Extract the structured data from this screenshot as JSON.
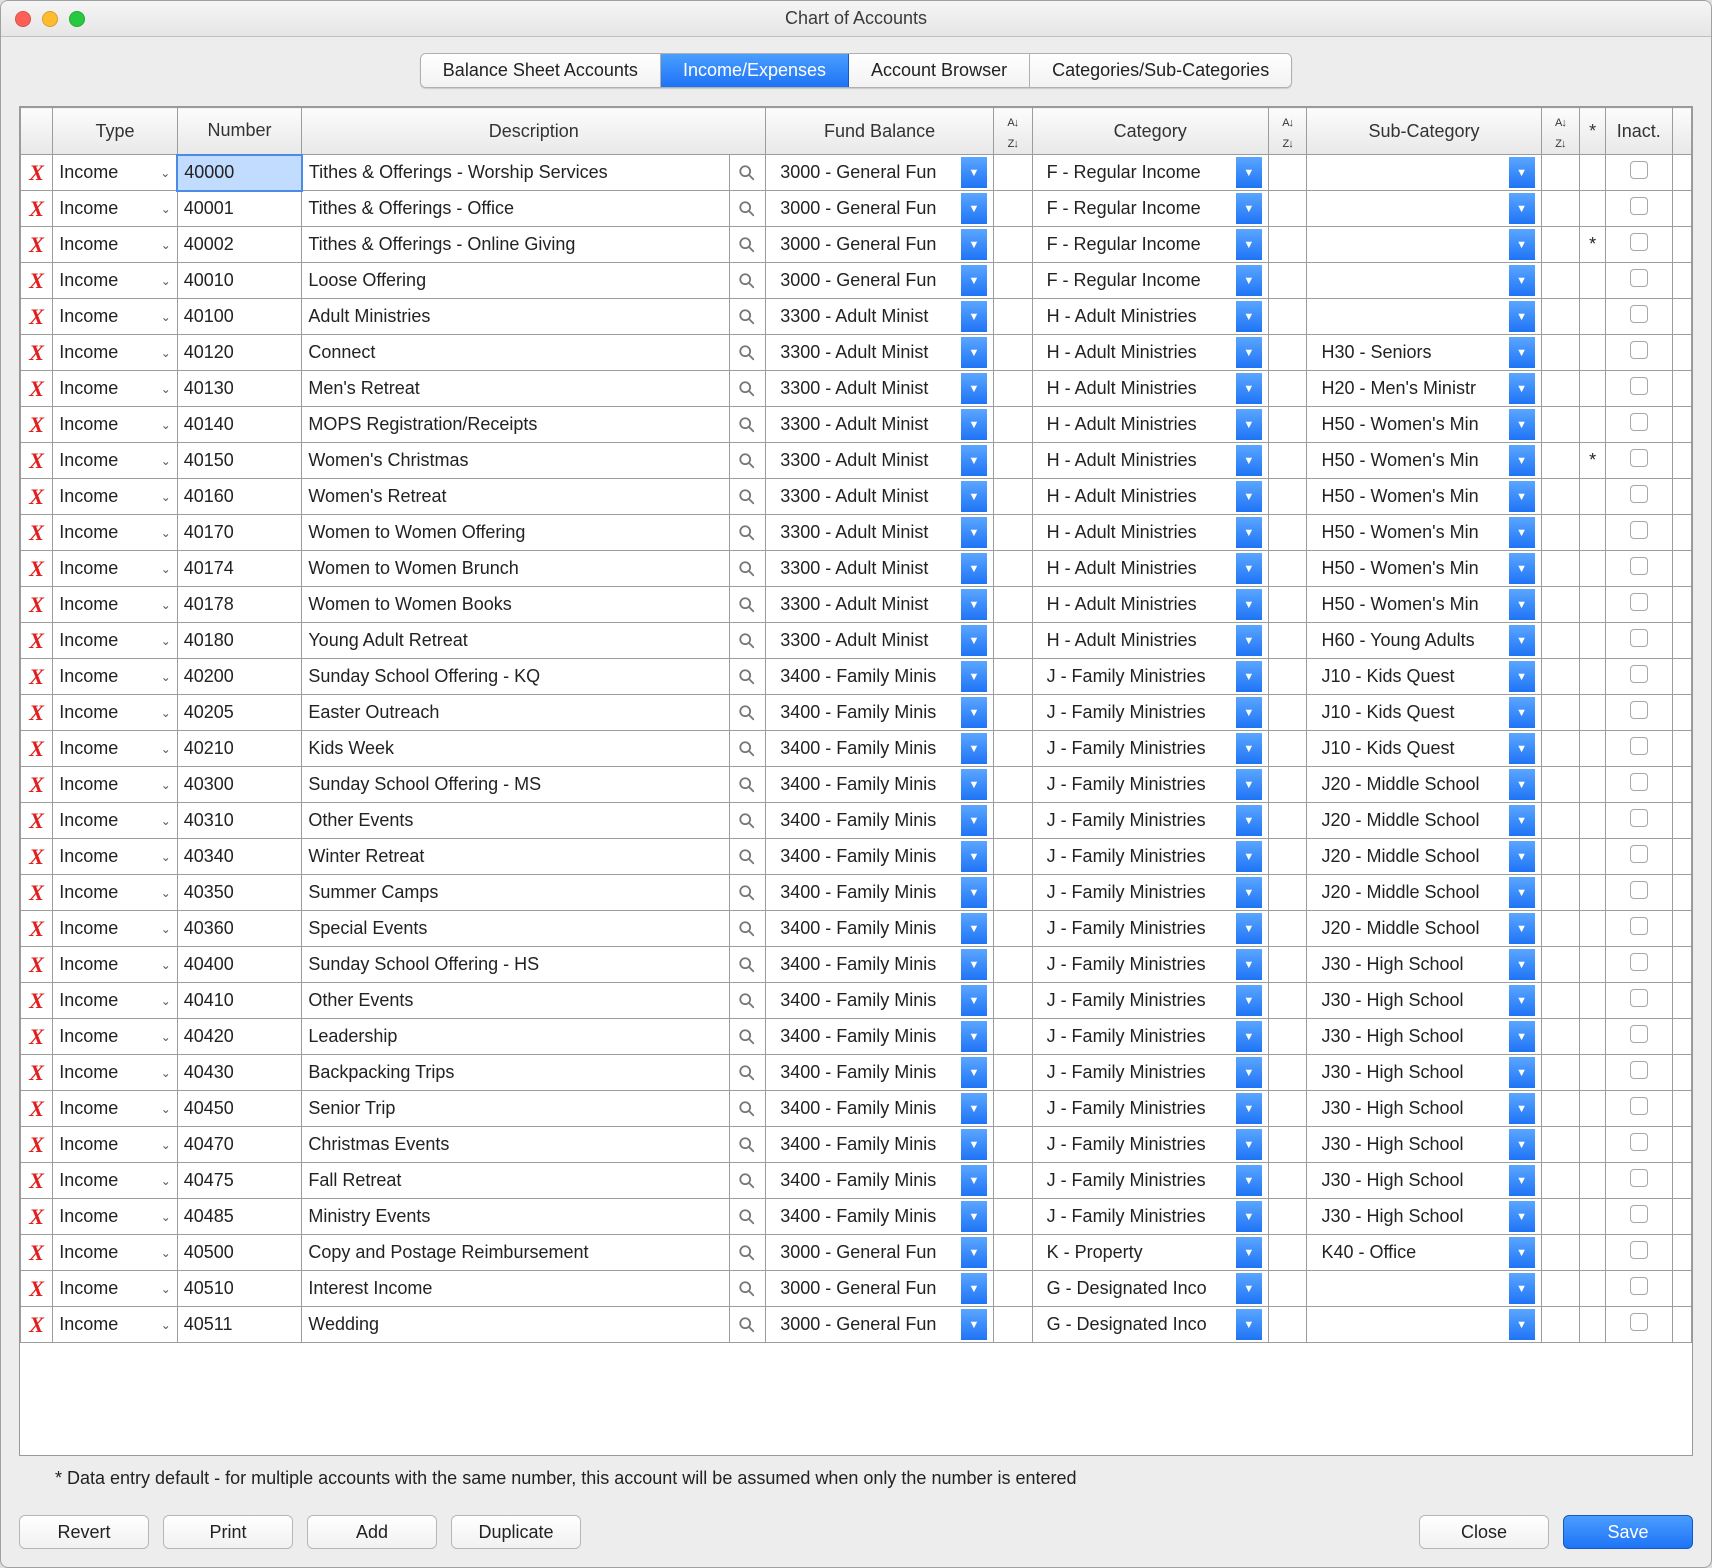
{
  "window": {
    "title": "Chart of Accounts"
  },
  "tabs": [
    {
      "id": "balance",
      "label": "Balance Sheet Accounts",
      "active": false
    },
    {
      "id": "income",
      "label": "Income/Expenses",
      "active": true
    },
    {
      "id": "browser",
      "label": "Account Browser",
      "active": false
    },
    {
      "id": "cats",
      "label": "Categories/Sub-Categories",
      "active": false
    }
  ],
  "headers": {
    "type": "Type",
    "number": "Number",
    "description": "Description",
    "fund": "Fund Balance",
    "category": "Category",
    "subcategory": "Sub-Category",
    "star": "*",
    "inact": "Inact."
  },
  "footnote": "* Data entry default - for multiple accounts with the same number, this account will be assumed when only the number is entered",
  "buttons": {
    "revert": "Revert",
    "print": "Print",
    "add": "Add",
    "duplicate": "Duplicate",
    "close": "Close",
    "save": "Save"
  },
  "rows": [
    {
      "type": "Income",
      "number": "40000",
      "number_selected": true,
      "desc": "Tithes & Offerings - Worship Services",
      "fund": "3000 - General Fun",
      "cat": "F - Regular Income",
      "sub": "",
      "star": "",
      "inact": false
    },
    {
      "type": "Income",
      "number": "40001",
      "desc": "Tithes & Offerings - Office",
      "fund": "3000 - General Fun",
      "cat": "F - Regular Income",
      "sub": "",
      "star": "",
      "inact": false
    },
    {
      "type": "Income",
      "number": "40002",
      "desc": "Tithes & Offerings - Online Giving",
      "fund": "3000 - General Fun",
      "cat": "F - Regular Income",
      "sub": "",
      "star": "*",
      "inact": false
    },
    {
      "type": "Income",
      "number": "40010",
      "desc": "Loose Offering",
      "fund": "3000 - General Fun",
      "cat": "F - Regular Income",
      "sub": "",
      "star": "",
      "inact": false
    },
    {
      "type": "Income",
      "number": "40100",
      "desc": "Adult Ministries",
      "fund": "3300 - Adult Minist",
      "cat": "H - Adult Ministries",
      "sub": "",
      "star": "",
      "inact": false
    },
    {
      "type": "Income",
      "number": "40120",
      "desc": "Connect",
      "fund": "3300 - Adult Minist",
      "cat": "H - Adult Ministries",
      "sub": "H30 - Seniors",
      "star": "",
      "inact": false
    },
    {
      "type": "Income",
      "number": "40130",
      "desc": "Men's Retreat",
      "fund": "3300 - Adult Minist",
      "cat": "H - Adult Ministries",
      "sub": "H20 - Men's Ministr",
      "star": "",
      "inact": false
    },
    {
      "type": "Income",
      "number": "40140",
      "desc": "MOPS Registration/Receipts",
      "fund": "3300 - Adult Minist",
      "cat": "H - Adult Ministries",
      "sub": "H50 - Women's Min",
      "star": "",
      "inact": false
    },
    {
      "type": "Income",
      "number": "40150",
      "desc": "Women's Christmas",
      "fund": "3300 - Adult Minist",
      "cat": "H - Adult Ministries",
      "sub": "H50 - Women's Min",
      "star": "*",
      "inact": false
    },
    {
      "type": "Income",
      "number": "40160",
      "desc": "Women's Retreat",
      "fund": "3300 - Adult Minist",
      "cat": "H - Adult Ministries",
      "sub": "H50 - Women's Min",
      "star": "",
      "inact": false
    },
    {
      "type": "Income",
      "number": "40170",
      "desc": "Women to Women Offering",
      "fund": "3300 - Adult Minist",
      "cat": "H - Adult Ministries",
      "sub": "H50 - Women's Min",
      "star": "",
      "inact": false
    },
    {
      "type": "Income",
      "number": "40174",
      "desc": "Women to Women Brunch",
      "fund": "3300 - Adult Minist",
      "cat": "H - Adult Ministries",
      "sub": "H50 - Women's Min",
      "star": "",
      "inact": false
    },
    {
      "type": "Income",
      "number": "40178",
      "desc": "Women to Women Books",
      "fund": "3300 - Adult Minist",
      "cat": "H - Adult Ministries",
      "sub": "H50 - Women's Min",
      "star": "",
      "inact": false
    },
    {
      "type": "Income",
      "number": "40180",
      "desc": "Young Adult Retreat",
      "fund": "3300 - Adult Minist",
      "cat": "H - Adult Ministries",
      "sub": "H60 - Young Adults",
      "star": "",
      "inact": false
    },
    {
      "type": "Income",
      "number": "40200",
      "desc": "Sunday School Offering - KQ",
      "fund": "3400 - Family Minis",
      "cat": "J - Family Ministries",
      "sub": "J10 - Kids Quest",
      "star": "",
      "inact": false
    },
    {
      "type": "Income",
      "number": "40205",
      "desc": "Easter Outreach",
      "fund": "3400 - Family Minis",
      "cat": "J - Family Ministries",
      "sub": "J10 - Kids Quest",
      "star": "",
      "inact": false
    },
    {
      "type": "Income",
      "number": "40210",
      "desc": "Kids Week",
      "fund": "3400 - Family Minis",
      "cat": "J - Family Ministries",
      "sub": "J10 - Kids Quest",
      "star": "",
      "inact": false
    },
    {
      "type": "Income",
      "number": "40300",
      "desc": "Sunday School Offering - MS",
      "fund": "3400 - Family Minis",
      "cat": "J - Family Ministries",
      "sub": "J20 - Middle School",
      "star": "",
      "inact": false
    },
    {
      "type": "Income",
      "number": "40310",
      "desc": "Other Events",
      "fund": "3400 - Family Minis",
      "cat": "J - Family Ministries",
      "sub": "J20 - Middle School",
      "star": "",
      "inact": false
    },
    {
      "type": "Income",
      "number": "40340",
      "desc": "Winter Retreat",
      "fund": "3400 - Family Minis",
      "cat": "J - Family Ministries",
      "sub": "J20 - Middle School",
      "star": "",
      "inact": false
    },
    {
      "type": "Income",
      "number": "40350",
      "desc": "Summer Camps",
      "fund": "3400 - Family Minis",
      "cat": "J - Family Ministries",
      "sub": "J20 - Middle School",
      "star": "",
      "inact": false
    },
    {
      "type": "Income",
      "number": "40360",
      "desc": "Special Events",
      "fund": "3400 - Family Minis",
      "cat": "J - Family Ministries",
      "sub": "J20 - Middle School",
      "star": "",
      "inact": false
    },
    {
      "type": "Income",
      "number": "40400",
      "desc": "Sunday School Offering - HS",
      "fund": "3400 - Family Minis",
      "cat": "J - Family Ministries",
      "sub": "J30 - High School",
      "star": "",
      "inact": false
    },
    {
      "type": "Income",
      "number": "40410",
      "desc": "Other Events",
      "fund": "3400 - Family Minis",
      "cat": "J - Family Ministries",
      "sub": "J30 - High School",
      "star": "",
      "inact": false
    },
    {
      "type": "Income",
      "number": "40420",
      "desc": "Leadership",
      "fund": "3400 - Family Minis",
      "cat": "J - Family Ministries",
      "sub": "J30 - High School",
      "star": "",
      "inact": false
    },
    {
      "type": "Income",
      "number": "40430",
      "desc": "Backpacking Trips",
      "fund": "3400 - Family Minis",
      "cat": "J - Family Ministries",
      "sub": "J30 - High School",
      "star": "",
      "inact": false
    },
    {
      "type": "Income",
      "number": "40450",
      "desc": "Senior Trip",
      "fund": "3400 - Family Minis",
      "cat": "J - Family Ministries",
      "sub": "J30 - High School",
      "star": "",
      "inact": false
    },
    {
      "type": "Income",
      "number": "40470",
      "desc": "Christmas Events",
      "fund": "3400 - Family Minis",
      "cat": "J - Family Ministries",
      "sub": "J30 - High School",
      "star": "",
      "inact": false
    },
    {
      "type": "Income",
      "number": "40475",
      "desc": "Fall Retreat",
      "fund": "3400 - Family Minis",
      "cat": "J - Family Ministries",
      "sub": "J30 - High School",
      "star": "",
      "inact": false
    },
    {
      "type": "Income",
      "number": "40485",
      "desc": "Ministry Events",
      "fund": "3400 - Family Minis",
      "cat": "J - Family Ministries",
      "sub": "J30 - High School",
      "star": "",
      "inact": false
    },
    {
      "type": "Income",
      "number": "40500",
      "desc": "Copy and Postage Reimbursement",
      "fund": "3000 - General Fun",
      "cat": "K - Property",
      "sub": "K40 - Office",
      "star": "",
      "inact": false
    },
    {
      "type": "Income",
      "number": "40510",
      "desc": "Interest Income",
      "fund": "3000 - General Fun",
      "cat": "G - Designated Inco",
      "sub": "",
      "star": "",
      "inact": false
    },
    {
      "type": "Income",
      "number": "40511",
      "desc": "Wedding",
      "fund": "3000 - General Fun",
      "cat": "G - Designated Inco",
      "sub": "",
      "star": "",
      "inact": false
    }
  ]
}
